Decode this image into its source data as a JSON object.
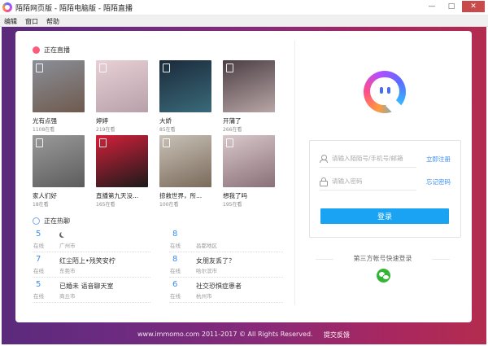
{
  "window": {
    "title": "陌陌网页版 - 陌陌电脑版 - 陌陌直播",
    "buttons": [
      "—",
      "□",
      "✕"
    ]
  },
  "menu": [
    "编辑",
    "窗口",
    "帮助"
  ],
  "live": {
    "heading": "正在直播",
    "items": [
      {
        "name": "光有点强",
        "viewers": "1108在看",
        "colors": [
          "#8a8f99",
          "#6f5a4d"
        ]
      },
      {
        "name": "婷婷",
        "viewers": "219在看",
        "colors": [
          "#e8d0d6",
          "#b8a0aa"
        ]
      },
      {
        "name": "大娇",
        "viewers": "85在看",
        "colors": [
          "#1b2a3a",
          "#3a6a7a"
        ]
      },
      {
        "name": "开蒲了",
        "viewers": "266在看",
        "colors": [
          "#4a3e44",
          "#b9a6a6"
        ]
      },
      {
        "name": "家人们好",
        "viewers": "18在看",
        "colors": [
          "#9a9a9a",
          "#5c5c5c"
        ]
      },
      {
        "name": "直播第九天没...",
        "viewers": "165在看",
        "colors": [
          "#d4203a",
          "#1a1a1a"
        ]
      },
      {
        "name": "掠救世界，所...",
        "viewers": "100在看",
        "colors": [
          "#c9c2b8",
          "#7a6a5a"
        ]
      },
      {
        "name": "想我了吗",
        "viewers": "195在看",
        "colors": [
          "#d8c8cc",
          "#8a7078"
        ]
      }
    ]
  },
  "chat": {
    "heading": "正在热聊",
    "online_label": "在线",
    "rows": [
      {
        "count": "5",
        "title": "",
        "location": "广州市",
        "moon": true
      },
      {
        "count": "8",
        "title": "",
        "location": "昌都地区",
        "moon": false
      },
      {
        "count": "7",
        "title": "红尘陌上•残笑安柠",
        "location": "东莞市",
        "moon": false
      },
      {
        "count": "8",
        "title": "女朋友丢了？",
        "location": "哈尔滨市",
        "moon": false
      },
      {
        "count": "5",
        "title": "已婚未 语音聊天室",
        "location": "商丘市",
        "moon": false
      },
      {
        "count": "6",
        "title": "社交恐惧症患者",
        "location": "杭州市",
        "moon": false
      }
    ]
  },
  "login": {
    "account_placeholder": "请输入陌陌号/手机号/邮箱",
    "password_placeholder": "请输入密码",
    "register_link": "立即注册",
    "forgot_link": "忘记密码",
    "login_button": "登录",
    "third_party_label": "第三方帐号快速登录"
  },
  "footer": {
    "copyright": "www.immomo.com 2011-2017 © All Rights Reserved.",
    "feedback": "提交反馈"
  },
  "colors": {
    "accent": "#1aa3f2",
    "link": "#3b8ef0",
    "background_left": "#5b2a7c",
    "background_right": "#b32c4f",
    "wechat": "#35b535"
  }
}
